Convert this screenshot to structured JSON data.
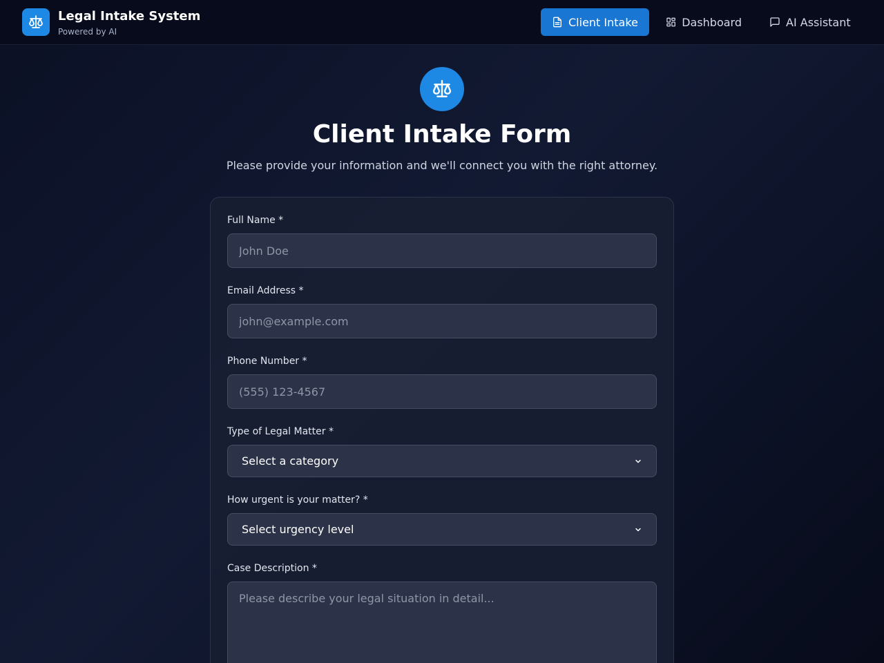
{
  "header": {
    "title": "Legal Intake System",
    "subtitle": "Powered by AI",
    "nav": {
      "client_intake": "Client Intake",
      "dashboard": "Dashboard",
      "ai_assistant": "AI Assistant"
    }
  },
  "hero": {
    "title": "Client Intake Form",
    "subtitle": "Please provide your information and we'll connect you with the right attorney."
  },
  "form": {
    "full_name": {
      "label": "Full Name *",
      "placeholder": "John Doe"
    },
    "email": {
      "label": "Email Address *",
      "placeholder": "john@example.com"
    },
    "phone": {
      "label": "Phone Number *",
      "placeholder": "(555) 123-4567"
    },
    "matter_type": {
      "label": "Type of Legal Matter *",
      "value": "Select a category"
    },
    "urgency": {
      "label": "How urgent is your matter? *",
      "value": "Select urgency level"
    },
    "description": {
      "label": "Case Description *",
      "placeholder": "Please describe your legal situation in detail..."
    }
  },
  "colors": {
    "accent": "#1e88e5",
    "nav_active": "#1976d2",
    "header_bg": "#070b1c"
  },
  "icons": {
    "brand": "scale-icon",
    "hero": "scale-icon",
    "client_intake": "document-icon",
    "dashboard": "grid-icon",
    "ai_assistant": "chat-icon",
    "select": "chevron-down-icon"
  }
}
